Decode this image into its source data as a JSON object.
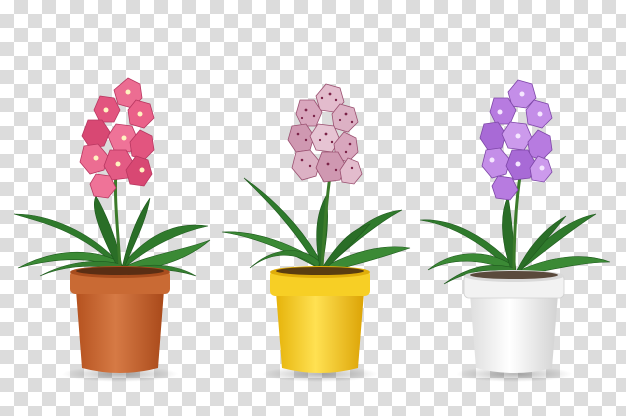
{
  "background": {
    "pattern": "transparency-checkerboard",
    "colors": [
      "#ffffff",
      "#dcdcdc"
    ]
  },
  "plants": [
    {
      "name": "pink-orchid",
      "flower_color": "#e2557f",
      "pot_color": "#c4612d"
    },
    {
      "name": "spotted-orchid",
      "flower_color": "#d8a6bd",
      "pot_color": "#f3c81c"
    },
    {
      "name": "purple-orchid",
      "flower_color": "#b77be0",
      "pot_color": "#f5f5f5"
    }
  ]
}
